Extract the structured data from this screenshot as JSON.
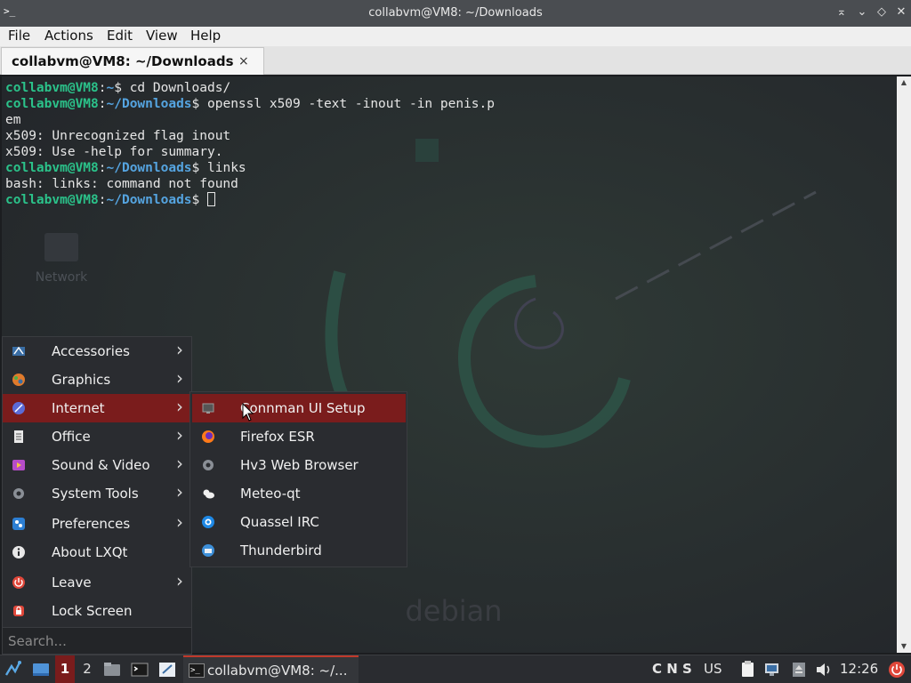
{
  "window": {
    "title": "collabvm@VM8: ~/Downloads",
    "menu": [
      "File",
      "Actions",
      "Edit",
      "View",
      "Help"
    ],
    "tab_label": "collabvm@VM8: ~/Downloads",
    "tab_close": "×"
  },
  "terminal": {
    "prompt_user": "collabvm@VM8",
    "lines": [
      {
        "type": "prompt",
        "path": "~",
        "cmd": "cd Downloads/"
      },
      {
        "type": "prompt",
        "path": "~/Downloads",
        "cmd": "openssl x509 -text -inout -in penis.p"
      },
      {
        "type": "out",
        "text": "em"
      },
      {
        "type": "out",
        "text": "x509: Unrecognized flag inout"
      },
      {
        "type": "out",
        "text": "x509: Use -help for summary."
      },
      {
        "type": "prompt",
        "path": "~/Downloads",
        "cmd": "links"
      },
      {
        "type": "out",
        "text": "bash: links: command not found"
      },
      {
        "type": "prompt",
        "path": "~/Downloads",
        "cmd": "",
        "cursor": true
      }
    ]
  },
  "desktop": {
    "network_label": "Network",
    "debian_label": "debian"
  },
  "start_menu": {
    "items": [
      {
        "label": "Accessories",
        "icon": "accessories-icon",
        "color": "#3a6ea5",
        "submenu": true
      },
      {
        "label": "Graphics",
        "icon": "graphics-icon",
        "color": "#e07b2c",
        "submenu": true
      },
      {
        "label": "Internet",
        "icon": "internet-icon",
        "color": "#5b6bd6",
        "submenu": true,
        "active": true
      },
      {
        "label": "Office",
        "icon": "office-icon",
        "color": "#e8e8e8",
        "submenu": true
      },
      {
        "label": "Sound & Video",
        "icon": "sound-video-icon",
        "color": "#b64cc9",
        "submenu": true
      },
      {
        "label": "System Tools",
        "icon": "system-tools-icon",
        "color": "#8a8f96",
        "submenu": true
      },
      {
        "label": "Preferences",
        "icon": "preferences-icon",
        "color": "#2d7fd3",
        "submenu": true
      },
      {
        "label": "About LXQt",
        "icon": "info-icon",
        "color": "#e8e8e8",
        "submenu": false
      },
      {
        "label": "Leave",
        "icon": "power-icon",
        "color": "#e0473a",
        "submenu": true
      },
      {
        "label": "Lock Screen",
        "icon": "lock-icon",
        "color": "#e0473a",
        "submenu": false
      }
    ],
    "search_placeholder": "Search..."
  },
  "internet_submenu": {
    "items": [
      {
        "label": "Connman UI Setup",
        "icon": "connman-icon",
        "active": true
      },
      {
        "label": "Firefox ESR",
        "icon": "firefox-icon"
      },
      {
        "label": "Hv3 Web Browser",
        "icon": "hv3-icon"
      },
      {
        "label": "Meteo-qt",
        "icon": "meteo-icon"
      },
      {
        "label": "Quassel IRC",
        "icon": "quassel-icon"
      },
      {
        "label": "Thunderbird",
        "icon": "thunderbird-icon"
      }
    ]
  },
  "taskbar": {
    "workspace_1": "1",
    "workspace_2": "2",
    "task_label": "collabvm@VM8: ~/...",
    "tray_cns": "C N S",
    "keyboard_layout": "US",
    "clock": "12:26"
  }
}
